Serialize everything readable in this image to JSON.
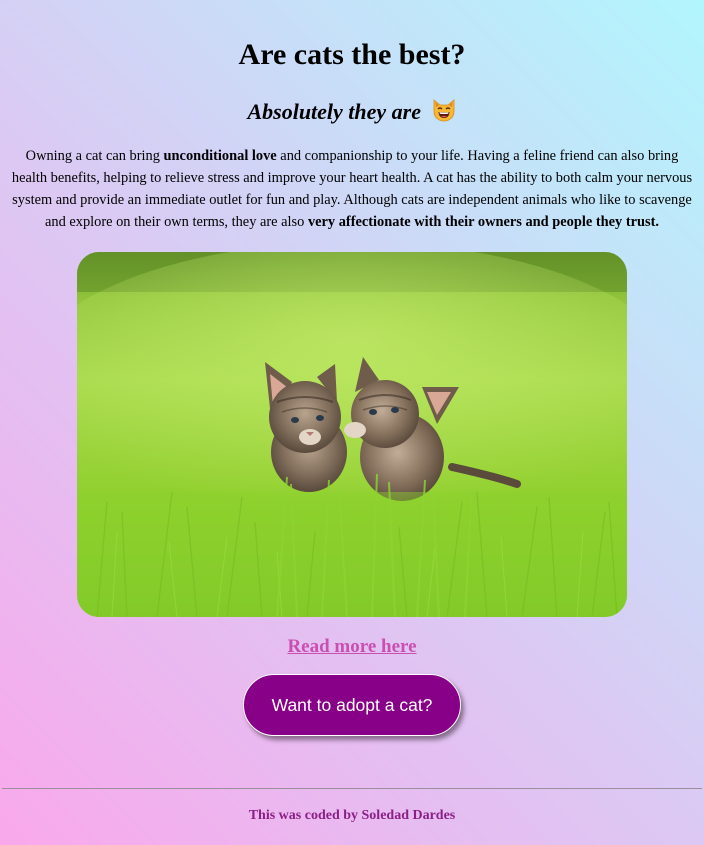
{
  "header": {
    "title": "Are cats the best?",
    "subtitle": "Absolutely they are"
  },
  "intro": {
    "part1": "Owning a cat can bring ",
    "bold1": "unconditional love",
    "part2": " and companionship to your life. Having a feline friend can also bring health benefits, helping to relieve stress and improve your heart health. A cat has the ability to both calm your nervous system and provide an immediate outlet for fun and play. Although cats are independent animals who like to scavenge and explore on their own terms, they are also ",
    "bold2": "very affectionate with their owners and people they trust."
  },
  "image": {
    "alt": "Two kittens nuzzling in grass"
  },
  "links": {
    "read_more": "Read more here"
  },
  "buttons": {
    "adopt": "Want to adopt a cat?"
  },
  "footer": {
    "credit": "This was coded by Soledad Dardes"
  },
  "icons": {
    "subtitle_emoji": "grinning-cat-emoji"
  },
  "colors": {
    "link": "#c94fb0",
    "button_bg": "#880088",
    "footer_text": "#8a1f86"
  }
}
